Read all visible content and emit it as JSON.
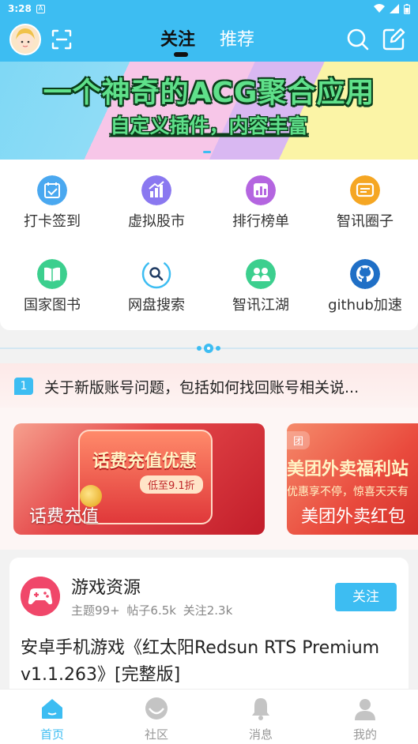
{
  "status_bar": {
    "time": "3:28",
    "notif_badge": "A"
  },
  "header": {
    "tabs": [
      {
        "label": "关注",
        "active": true
      },
      {
        "label": "推荐",
        "active": false
      }
    ]
  },
  "banner": {
    "title": "一个神奇的ACG聚合应用",
    "subtitle": "自定义插件，内容丰富"
  },
  "grid": {
    "items": [
      {
        "label": "打卡签到",
        "icon": "checkin-calendar-icon",
        "color": "#4aa8f0"
      },
      {
        "label": "虚拟股市",
        "icon": "stock-chart-icon",
        "color": "#8a78f0"
      },
      {
        "label": "排行榜单",
        "icon": "ranking-bars-icon",
        "color": "#b465e0"
      },
      {
        "label": "智讯圈子",
        "icon": "chat-bubble-icon",
        "color": "#f5a623"
      },
      {
        "label": "国家图书",
        "icon": "book-icon",
        "color": "#3ccf8e"
      },
      {
        "label": "网盘搜索",
        "icon": "search-circle-icon",
        "color": "#3dbdf2"
      },
      {
        "label": "智讯江湖",
        "icon": "people-icon",
        "color": "#3ccf8e"
      },
      {
        "label": "github加速",
        "icon": "github-icon",
        "color": "#1f6fc6"
      }
    ]
  },
  "notice": {
    "badge": "1",
    "text": "关于新版账号问题，包括如何找回账号相关说..."
  },
  "promos": [
    {
      "label": "话费充值",
      "headline": "话费充值优惠",
      "pill": "低至9.1折"
    },
    {
      "label": "美团外卖红包",
      "tag": "团",
      "headline": "美团外卖福利站",
      "sub": "优惠享不停，惊喜天天有"
    }
  ],
  "post": {
    "forum_name": "游戏资源",
    "stats": "主题99+  帖子6.5k  关注2.3k",
    "follow_label": "关注",
    "title": "安卓手机游戏《红太阳Redsun RTS Premium v1.1.263》[完整版]"
  },
  "bottom_nav": [
    {
      "label": "首页",
      "icon": "home-icon",
      "active": true
    },
    {
      "label": "社区",
      "icon": "community-icon",
      "active": false
    },
    {
      "label": "消息",
      "icon": "bell-icon",
      "active": false
    },
    {
      "label": "我的",
      "icon": "profile-icon",
      "active": false
    }
  ],
  "colors": {
    "accent": "#3dbdf2",
    "banner_text": "#5fe08a"
  }
}
